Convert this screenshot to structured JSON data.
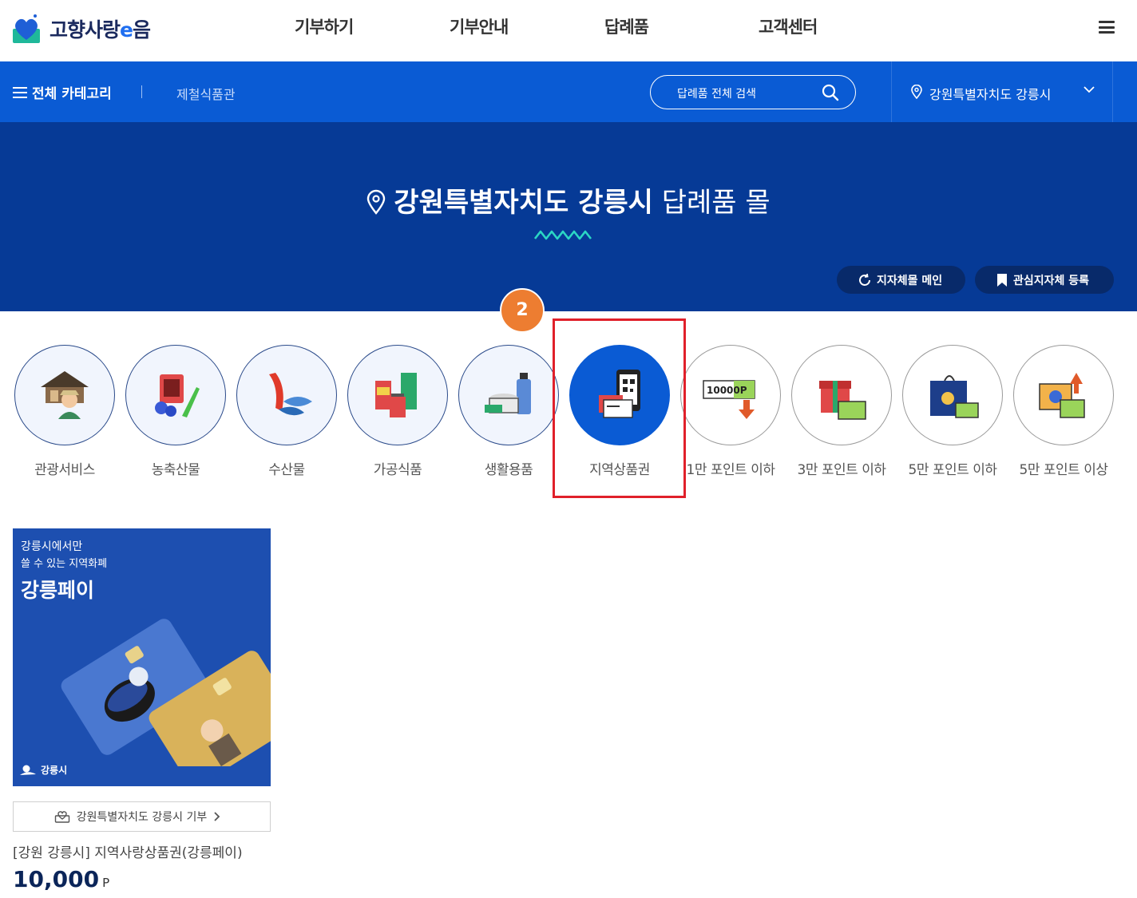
{
  "header": {
    "logo_text_a": "고향사랑",
    "logo_text_e": "e",
    "logo_text_b": "음",
    "nav": [
      "기부하기",
      "기부안내",
      "답례품",
      "고객센터"
    ],
    "menu_icon": "hamburger-icon"
  },
  "navbar": {
    "category_label": "전체 카테고리",
    "sub_link": "제철식품관",
    "search_placeholder": "답례품 전체 검색",
    "region": "강원특별자치도 강릉시"
  },
  "hero": {
    "region_bold": "강원특별자치도 강릉시",
    "title_rest": "답례품 몰",
    "btn_main": "지자체몰 메인",
    "btn_fav": "관심지자체 등록"
  },
  "step_badge": "2",
  "categories": [
    {
      "label": "관광서비스",
      "icon": "tourism-icon"
    },
    {
      "label": "농축산물",
      "icon": "agriculture-icon"
    },
    {
      "label": "수산물",
      "icon": "seafood-icon"
    },
    {
      "label": "가공식품",
      "icon": "processed-food-icon"
    },
    {
      "label": "생활용품",
      "icon": "household-goods-icon"
    },
    {
      "label": "지역상품권",
      "icon": "local-voucher-icon",
      "active": true
    },
    {
      "label": "1만 포인트 이하",
      "icon": "points-10000-icon"
    },
    {
      "label": "3만 포인트 이하",
      "icon": "gift-box-icon"
    },
    {
      "label": "5만 포인트 이하",
      "icon": "shopping-bag-icon"
    },
    {
      "label": "5만 포인트 이상",
      "icon": "premium-gift-icon"
    }
  ],
  "product": {
    "img_line1": "강릉시에서만",
    "img_line2": "쓸 수 있는 지역화폐",
    "img_title": "강릉페이",
    "img_brand": "강릉시",
    "donate_label": "강원특별자치도 강릉시 기부",
    "name": "[강원 강릉시] 지역사랑상품권(강릉페이)",
    "price": "10,000",
    "price_unit": "P"
  },
  "colors": {
    "primary": "#0a5bd4",
    "hero_bg": "#063a96",
    "highlight": "#e0202a",
    "badge": "#ed7d31"
  }
}
